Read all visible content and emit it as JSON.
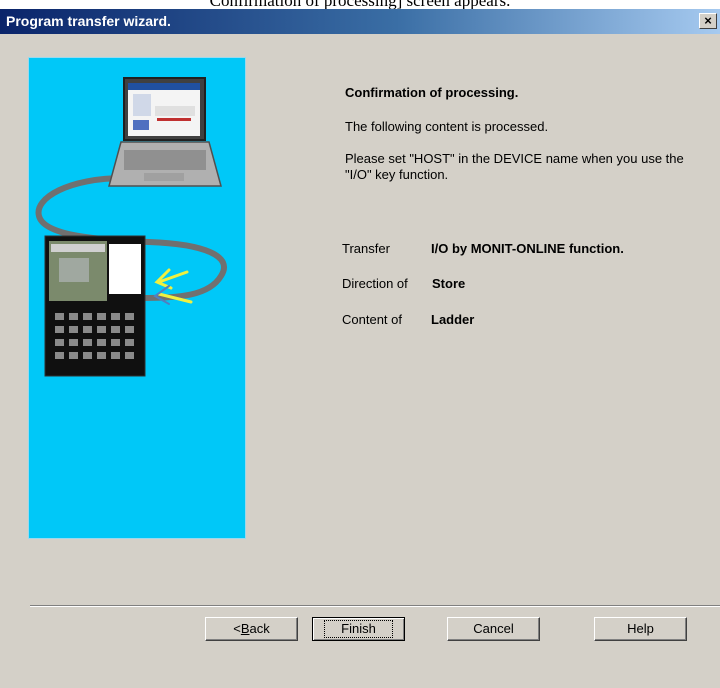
{
  "document_caption": "Confirmation of processing] screen appears.",
  "window": {
    "title": "Program transfer wizard.",
    "close_glyph": "×"
  },
  "content": {
    "heading": "Confirmation of processing.",
    "info_line": "The following content is processed.",
    "note": "Please set \"HOST\" in the DEVICE name when you use the \"I/O\" key function.",
    "rows": [
      {
        "label": "Transfer",
        "value": "I/O by MONIT-ONLINE function."
      },
      {
        "label": "Direction of",
        "value": "Store"
      },
      {
        "label": "Content of",
        "value": "Ladder"
      }
    ]
  },
  "buttons": {
    "back_arrow": "<",
    "back_mnemonic": "B",
    "back_rest": "ack",
    "finish": "Finish",
    "cancel": "Cancel",
    "help": "Help"
  },
  "colors": {
    "illustration_bg": "#00c8f8",
    "titlebar_start": "#0a246a",
    "dialog_bg": "#d4d0c8"
  },
  "icons": [
    "laptop-icon",
    "cnc-controller-icon",
    "transfer-cable-icon",
    "transfer-arrow-icon",
    "close-icon"
  ]
}
